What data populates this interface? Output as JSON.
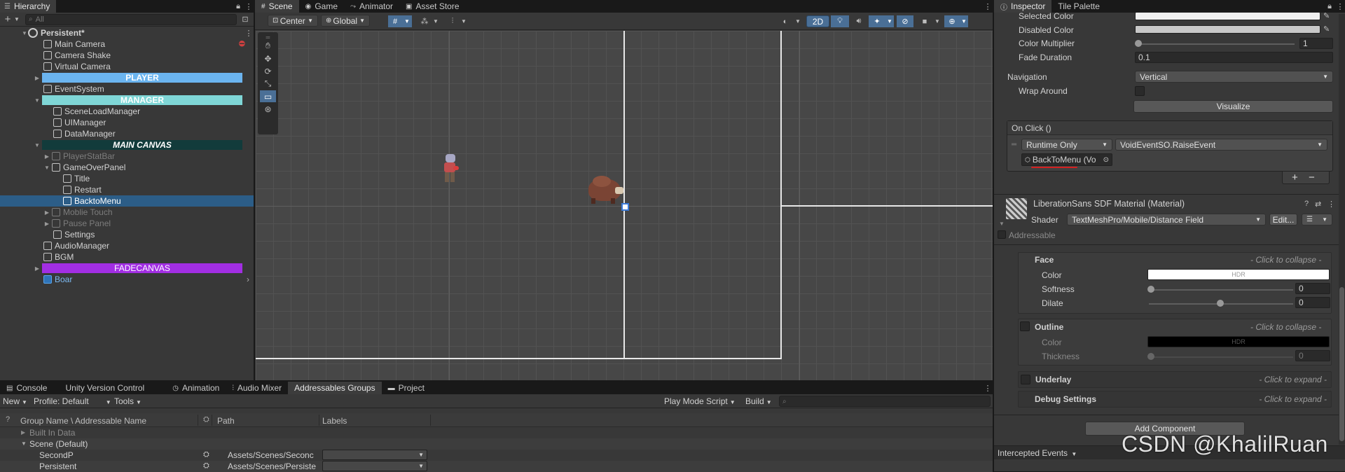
{
  "hierarchy": {
    "tab_label": "Hierarchy",
    "search_placeholder": "All",
    "scene_name": "Persistent*",
    "items": [
      {
        "label": "Main Camera"
      },
      {
        "label": "Camera Shake"
      },
      {
        "label": "Virtual Camera"
      },
      {
        "label": "PLAYER",
        "color": "#6bb4ef"
      },
      {
        "label": "EventSystem"
      },
      {
        "label": "MANAGER",
        "color": "#7fd6d6"
      },
      {
        "label": "SceneLoadManager"
      },
      {
        "label": "UIManager"
      },
      {
        "label": "DataManager"
      },
      {
        "label": "MAIN CANVAS",
        "color": "#123b3b"
      },
      {
        "label": "PlayerStatBar"
      },
      {
        "label": "GameOverPanel"
      },
      {
        "label": "Title"
      },
      {
        "label": "Restart"
      },
      {
        "label": "BacktoMenu"
      },
      {
        "label": "Moblie Touch"
      },
      {
        "label": "Pause Panel"
      },
      {
        "label": "Settings"
      },
      {
        "label": "AudioManager"
      },
      {
        "label": "BGM"
      },
      {
        "label": "FADECANVAS",
        "color": "#a22ee3"
      },
      {
        "label": "Boar"
      }
    ]
  },
  "scene_view": {
    "tabs": [
      "Scene",
      "Game",
      "Animator",
      "Asset Store"
    ],
    "pivot": "Center",
    "space": "Global",
    "mode_2d": "2D",
    "selection_color": "#4a6f96"
  },
  "inspector": {
    "tabs": [
      "Inspector",
      "Tile Palette"
    ],
    "selected_color_label": "Selected Color",
    "disabled_color_label": "Disabled Color",
    "color_multiplier_label": "Color Multiplier",
    "color_multiplier_value": "1",
    "fade_duration_label": "Fade Duration",
    "fade_duration_value": "0.1",
    "navigation_label": "Navigation",
    "navigation_value": "Vertical",
    "wrap_around_label": "Wrap Around",
    "visualize_label": "Visualize",
    "onclick_header": "On Click ()",
    "runtime_label": "Runtime Only",
    "function_label": "VoidEventSO.RaiseEvent",
    "object_ref": "BackToMenu (Vo",
    "add_label": "+",
    "remove_label": "−",
    "material_title": "LiberationSans SDF Material (Material)",
    "shader_label": "Shader",
    "shader_value": "TextMeshPro/Mobile/Distance Field",
    "edit_label": "Edit...",
    "addressable_label": "Addressable",
    "face_label": "Face",
    "collapse_hint": "- Click to collapse -",
    "expand_hint": "- Click to expand -",
    "color_label": "Color",
    "hdr_label": "HDR",
    "softness_label": "Softness",
    "softness_value": "0",
    "dilate_label": "Dilate",
    "dilate_value": "0",
    "outline_label": "Outline",
    "outline_color_label": "Color",
    "thickness_label": "Thickness",
    "thickness_value": "0",
    "underlay_label": "Underlay",
    "debug_label": "Debug Settings",
    "add_component_label": "Add Component",
    "intercepted_label": "Intercepted Events",
    "watermark": "CSDN @KhalilRuan"
  },
  "bottom": {
    "tabs": [
      "Console",
      "Unity Version Control",
      "Animation",
      "Audio Mixer",
      "Addressables Groups",
      "Project"
    ],
    "new_label": "New",
    "profile_label": "Profile: Default",
    "tools_label": "Tools",
    "play_mode_label": "Play Mode Script",
    "build_label": "Build",
    "col_name": "Group Name \\ Addressable Name",
    "col_path": "Path",
    "col_labels": "Labels",
    "rows": [
      {
        "name": "Built In Data",
        "path": ""
      },
      {
        "name": "Scene (Default)",
        "path": ""
      },
      {
        "name": "SecondP",
        "path": "Assets/Scenes/Seconc"
      },
      {
        "name": "Persistent",
        "path": "Assets/Scenes/Persiste"
      }
    ]
  }
}
